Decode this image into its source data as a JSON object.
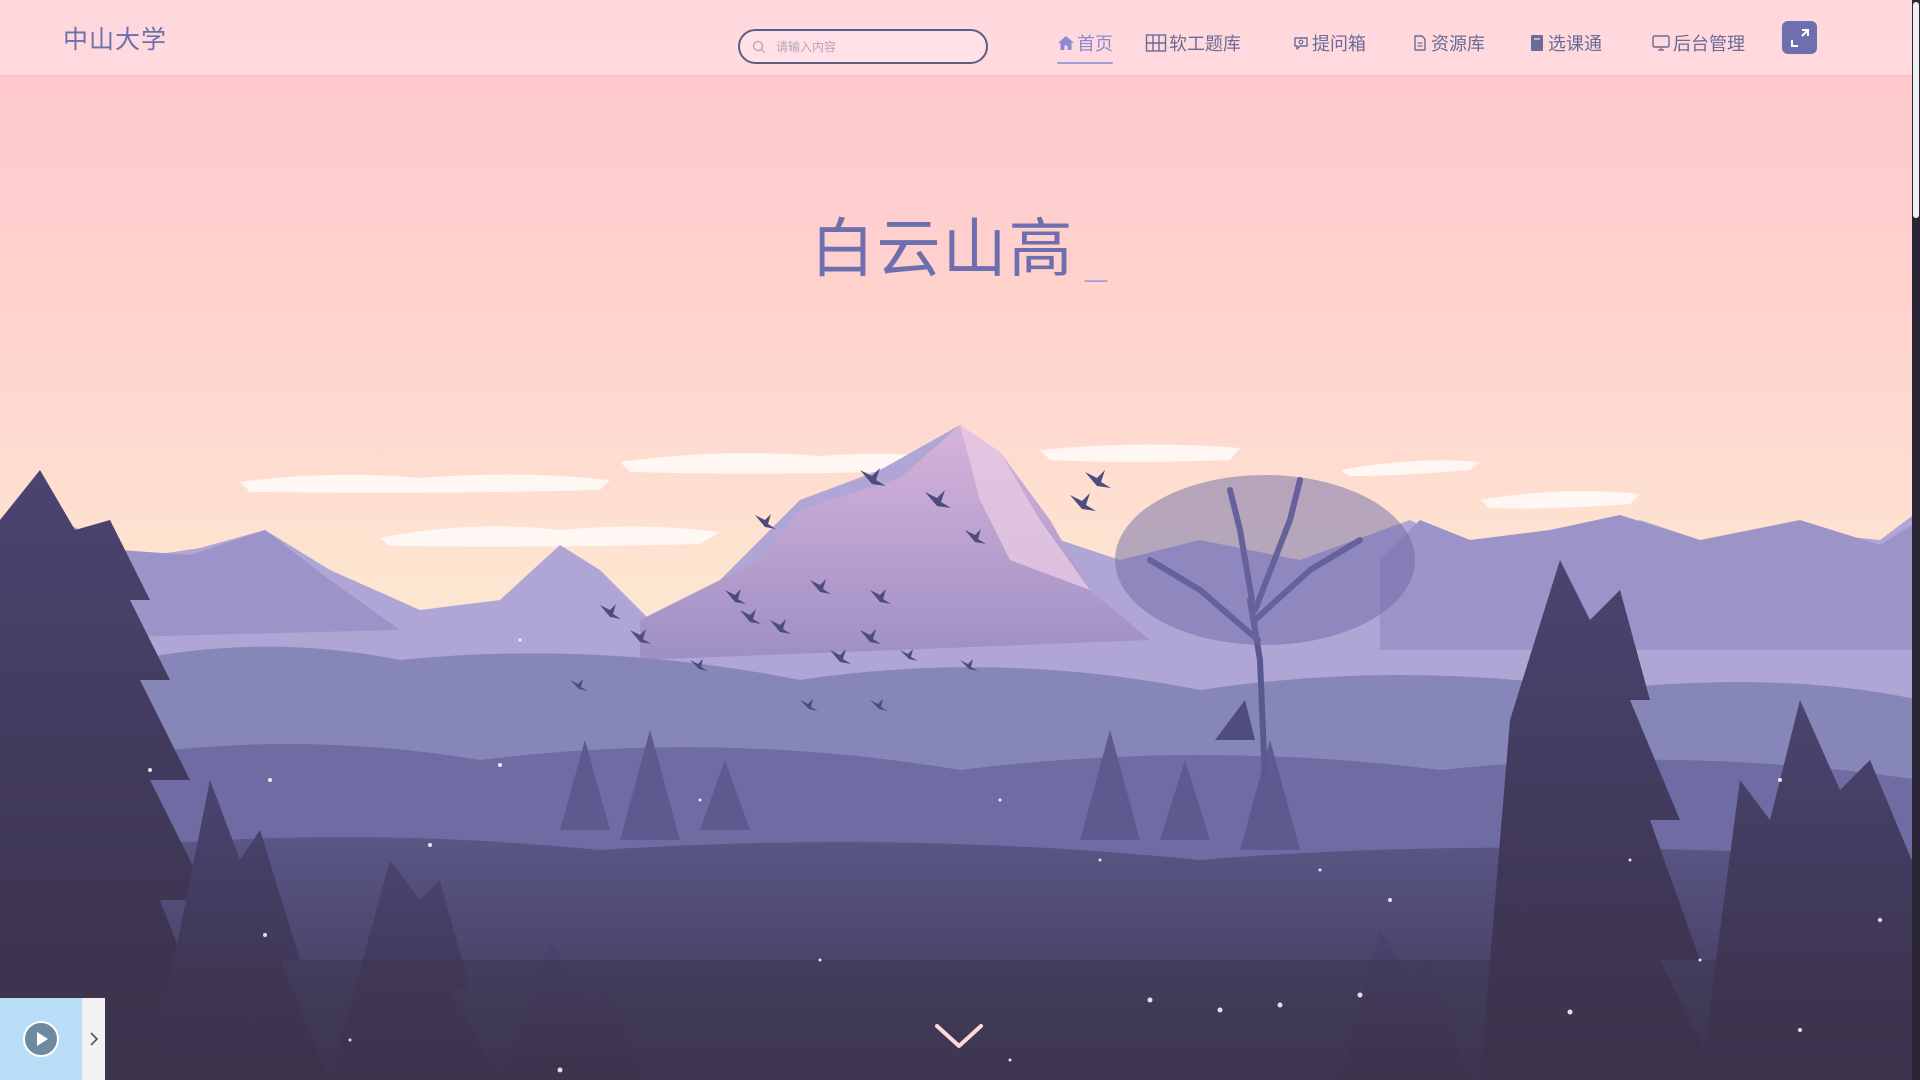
{
  "header": {
    "logo": "中山大学",
    "search_placeholder": "请输入内容"
  },
  "nav": {
    "items": [
      {
        "label": "首页",
        "icon": "home-icon",
        "active": true
      },
      {
        "label": "软工题库",
        "icon": "grid-icon",
        "active": false
      },
      {
        "label": "提问箱",
        "icon": "chat-icon",
        "active": false
      },
      {
        "label": "资源库",
        "icon": "document-icon",
        "active": false
      },
      {
        "label": "选课通",
        "icon": "notebook-icon",
        "active": false
      },
      {
        "label": "后台管理",
        "icon": "monitor-icon",
        "active": false
      }
    ],
    "fullscreen_icon": "fullscreen-icon"
  },
  "hero": {
    "title": "白云山高",
    "cursor": "_"
  },
  "colors": {
    "accent": "#6d6fae",
    "active": "#8a8bd1",
    "sky_top": "#ffc7cf",
    "sky_bottom": "#fde6d0",
    "forest_dark": "#3e3651"
  },
  "player": {
    "play_icon": "play-icon",
    "toggle_icon": "chevron-right-icon"
  },
  "scroll_hint_icon": "chevron-down-icon"
}
